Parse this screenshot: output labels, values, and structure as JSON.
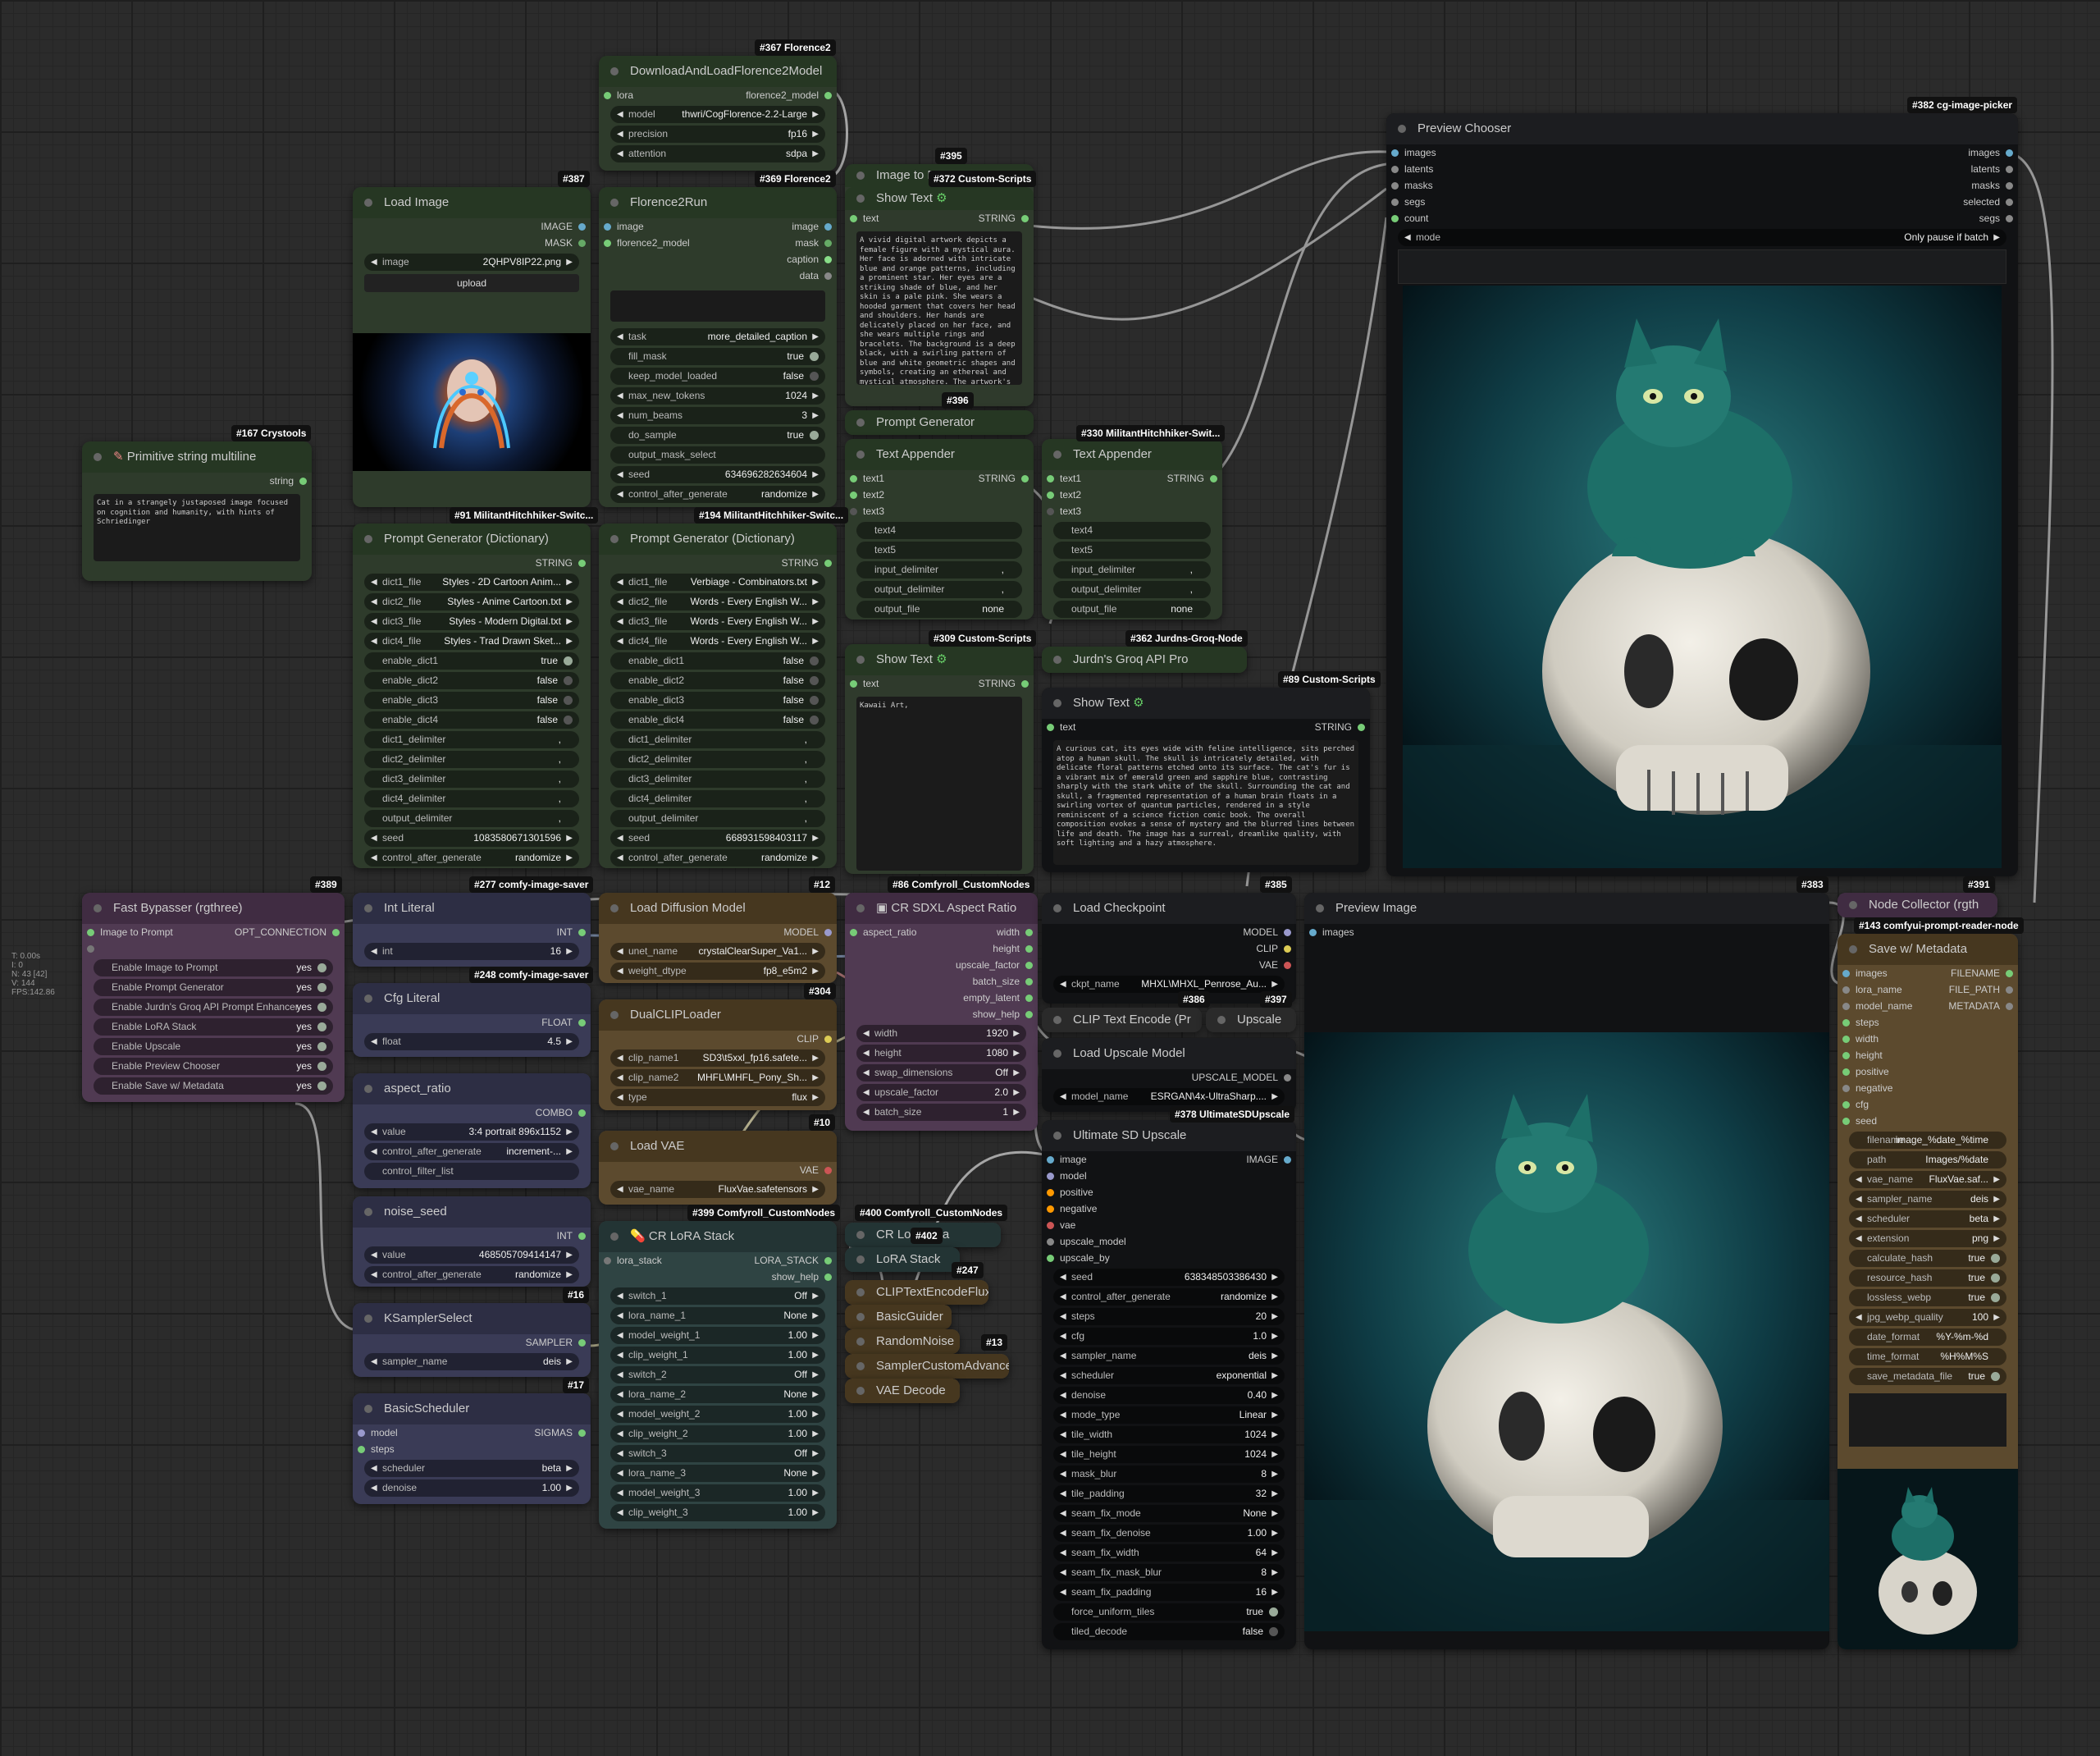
{
  "hud": [
    "T: 0.00s",
    "I: 0",
    "N: 43 [42]",
    "V: 144",
    "FPS:142.86"
  ],
  "nodes": {
    "florence_load": {
      "tag": "#367 Florence2",
      "title": "DownloadAndLoadFlorence2Model",
      "in": "lora",
      "out": "florence2_model",
      "w": [
        {
          "l": "model",
          "v": "thwri/CogFlorence-2.2-Large"
        },
        {
          "l": "precision",
          "v": "fp16"
        },
        {
          "l": "attention",
          "v": "sdpa"
        }
      ]
    },
    "load_image": {
      "tag": "#387",
      "title": "Load Image",
      "outs": [
        "IMAGE",
        "MASK"
      ],
      "w": [
        {
          "l": "image",
          "v": "2QHPV8IP22.png"
        }
      ],
      "upload": "upload"
    },
    "florence_run": {
      "tag": "#369 Florence2",
      "title": "Florence2Run",
      "ins": [
        "image",
        "florence2_model"
      ],
      "outs": [
        "image",
        "mask",
        "caption",
        "data"
      ],
      "w": [
        {
          "l": "task",
          "v": "more_detailed_caption",
          "t": "c"
        },
        {
          "l": "fill_mask",
          "v": "true",
          "t": "b"
        },
        {
          "l": "keep_model_loaded",
          "v": "false",
          "t": "b"
        },
        {
          "l": "max_new_tokens",
          "v": "1024",
          "t": "c"
        },
        {
          "l": "num_beams",
          "v": "3",
          "t": "c"
        },
        {
          "l": "do_sample",
          "v": "true",
          "t": "b"
        },
        {
          "l": "output_mask_select",
          "v": "",
          "t": "p"
        },
        {
          "l": "seed",
          "v": "634696282634604",
          "t": "c"
        },
        {
          "l": "control_after_generate",
          "v": "randomize",
          "t": "c"
        }
      ]
    },
    "show_text1": {
      "tag": "#372 Custom-Scripts",
      "tag2": "#395",
      "pre": "Image to P",
      "title": "Show Text",
      "in": "text",
      "out": "STRING",
      "text": "A vivid digital artwork depicts a female figure with a mystical aura. Her face is adorned with intricate blue and orange patterns, including a prominent star. Her eyes are a striking shade of blue, and her skin is a pale pink. She wears a hooded garment that covers her head and shoulders. Her hands are delicately placed on her face, and she wears multiple rings and bracelets. The background is a deep black, with a swirling pattern of blue and white geometric shapes and symbols, creating an ethereal and mystical atmosphere. The artwork's style resembles digital art, blending realism and"
    },
    "prompt_gen_node": {
      "tag": "#396",
      "title": "Prompt Generator",
      "sub": "MilitantHitchhiker-Swit..."
    },
    "primitive": {
      "tag": "#167 Crystools",
      "title": "Primitive string multiline",
      "out": "string",
      "text": "Cat in a strangely justaposed image focused on cognition and humanity, with hints of Schriedinger"
    },
    "pg1": {
      "tag": "#91 MilitantHitchhiker-Switc...",
      "title": "Prompt Generator (Dictionary)",
      "out": "STRING",
      "w": [
        {
          "l": "dict1_file",
          "v": "Styles - 2D Cartoon Anim...",
          "t": "c"
        },
        {
          "l": "dict2_file",
          "v": "Styles - Anime Cartoon.txt",
          "t": "c"
        },
        {
          "l": "dict3_file",
          "v": "Styles - Modern Digital.txt",
          "t": "c"
        },
        {
          "l": "dict4_file",
          "v": "Styles - Trad Drawn Sket...",
          "t": "c"
        },
        {
          "l": "enable_dict1",
          "v": "true",
          "t": "b"
        },
        {
          "l": "enable_dict2",
          "v": "false",
          "t": "b"
        },
        {
          "l": "enable_dict3",
          "v": "false",
          "t": "b"
        },
        {
          "l": "enable_dict4",
          "v": "false",
          "t": "b"
        },
        {
          "l": "dict1_delimiter",
          "v": ",",
          "t": "p"
        },
        {
          "l": "dict2_delimiter",
          "v": ",",
          "t": "p"
        },
        {
          "l": "dict3_delimiter",
          "v": ",",
          "t": "p"
        },
        {
          "l": "dict4_delimiter",
          "v": ",",
          "t": "p"
        },
        {
          "l": "output_delimiter",
          "v": ",",
          "t": "p"
        },
        {
          "l": "seed",
          "v": "1083580671301596",
          "t": "c"
        },
        {
          "l": "control_after_generate",
          "v": "randomize",
          "t": "c"
        }
      ]
    },
    "pg2": {
      "tag": "#194 MilitantHitchhiker-Switc...",
      "title": "Prompt Generator (Dictionary)",
      "out": "STRING",
      "w": [
        {
          "l": "dict1_file",
          "v": "Verbiage - Combinators.txt",
          "t": "c"
        },
        {
          "l": "dict2_file",
          "v": "Words - Every English W...",
          "t": "c"
        },
        {
          "l": "dict3_file",
          "v": "Words - Every English W...",
          "t": "c"
        },
        {
          "l": "dict4_file",
          "v": "Words - Every English W...",
          "t": "c"
        },
        {
          "l": "enable_dict1",
          "v": "false",
          "t": "b"
        },
        {
          "l": "enable_dict2",
          "v": "false",
          "t": "b"
        },
        {
          "l": "enable_dict3",
          "v": "false",
          "t": "b"
        },
        {
          "l": "enable_dict4",
          "v": "false",
          "t": "b"
        },
        {
          "l": "dict1_delimiter",
          "v": ",",
          "t": "p"
        },
        {
          "l": "dict2_delimiter",
          "v": ",",
          "t": "p"
        },
        {
          "l": "dict3_delimiter",
          "v": ",",
          "t": "p"
        },
        {
          "l": "dict4_delimiter",
          "v": ",",
          "t": "p"
        },
        {
          "l": "output_delimiter",
          "v": ",",
          "t": "p"
        },
        {
          "l": "seed",
          "v": "668931598403117",
          "t": "c"
        },
        {
          "l": "control_after_generate",
          "v": "randomize",
          "t": "c"
        }
      ]
    },
    "ta1": {
      "title": "Text Appender",
      "ins": [
        "text1",
        "text2",
        "text3"
      ],
      "out": "STRING",
      "w": [
        {
          "l": "text4",
          "v": ""
        },
        {
          "l": "text5",
          "v": ""
        },
        {
          "l": "input_delimiter",
          "v": ","
        },
        {
          "l": "output_delimiter",
          "v": ","
        },
        {
          "l": "output_file",
          "v": "none"
        }
      ]
    },
    "ta2": {
      "tag": "#330 MilitantHitchhiker-Swit...",
      "title": "Text Appender",
      "ins": [
        "text1",
        "text2",
        "text3"
      ],
      "out": "STRING",
      "w": [
        {
          "l": "text4",
          "v": ""
        },
        {
          "l": "text5",
          "v": ""
        },
        {
          "l": "input_delimiter",
          "v": ","
        },
        {
          "l": "output_delimiter",
          "v": ","
        },
        {
          "l": "output_file",
          "v": "none"
        }
      ]
    },
    "show_text2": {
      "tag": "#309 Custom-Scripts",
      "title": "Show Text",
      "in": "text",
      "out": "STRING",
      "text": "Kawaii Art,"
    },
    "groq": {
      "tag": "#362 Jurdns-Groq-Node",
      "title": "Jurdn's Groq API Pro"
    },
    "show_text3": {
      "tag": "#89 Custom-Scripts",
      "title": "Show Text",
      "in": "text",
      "out": "STRING",
      "text": "A curious cat, its eyes wide with feline intelligence, sits perched atop a human skull. The skull is intricately detailed, with delicate floral patterns etched onto its surface. The cat's fur is a vibrant mix of emerald green and sapphire blue, contrasting sharply with the stark white of the skull. Surrounding the cat and skull, a fragmented representation of a human brain floats in a swirling vortex of quantum particles, rendered in a style reminiscent of a science fiction comic book. The overall composition evokes a sense of mystery and the blurred lines between life and death. The image has a surreal, dreamlike quality, with soft lighting and a hazy atmosphere."
    },
    "preview_chooser": {
      "tag": "#382 cg-image-picker",
      "title": "Preview Chooser",
      "ins": [
        "images",
        "latents",
        "masks",
        "segs",
        "count"
      ],
      "outs": [
        "images",
        "latents",
        "masks",
        "selected",
        "segs"
      ],
      "w": [
        {
          "l": "mode",
          "v": "Only pause if batch"
        }
      ]
    },
    "fast_bypass": {
      "tag": "#389",
      "title": "Fast Bypasser (rgthree)",
      "in": "Image to Prompt",
      "out": "OPT_CONNECTION",
      "w": [
        {
          "l": "Enable Image to Prompt",
          "v": "yes"
        },
        {
          "l": "Enable Prompt Generator",
          "v": "yes"
        },
        {
          "l": "Enable Jurdn's Groq API Prompt Enhancer",
          "v": "yes"
        },
        {
          "l": "Enable LoRA Stack",
          "v": "yes"
        },
        {
          "l": "Enable Upscale",
          "v": "yes"
        },
        {
          "l": "Enable Preview Chooser",
          "v": "yes"
        },
        {
          "l": "Enable Save w/ Metadata",
          "v": "yes"
        }
      ]
    },
    "int_literal": {
      "tag": "#277 comfy-image-saver",
      "title": "Int Literal",
      "out": "INT",
      "w": [
        {
          "l": "int",
          "v": "16"
        }
      ]
    },
    "cfg_literal": {
      "tag": "#248 comfy-image-saver",
      "title": "Cfg Literal",
      "out": "FLOAT",
      "w": [
        {
          "l": "float",
          "v": "4.5"
        }
      ]
    },
    "aspect": {
      "title": "aspect_ratio",
      "out": "COMBO",
      "w": [
        {
          "l": "value",
          "v": "3:4 portrait 896x1152"
        },
        {
          "l": "control_after_generate",
          "v": "increment-..."
        },
        {
          "l": "control_filter_list",
          "v": ""
        }
      ]
    },
    "noise": {
      "title": "noise_seed",
      "out": "INT",
      "w": [
        {
          "l": "value",
          "v": "468505709414147"
        },
        {
          "l": "control_after_generate",
          "v": "randomize"
        }
      ]
    },
    "ksampler": {
      "tag": "#16",
      "title": "KSamplerSelect",
      "out": "SAMPLER",
      "w": [
        {
          "l": "sampler_name",
          "v": "deis"
        }
      ]
    },
    "basic_sched": {
      "tag": "#17",
      "title": "BasicScheduler",
      "ins": [
        "model",
        "steps"
      ],
      "out": "SIGMAS",
      "w": [
        {
          "l": "scheduler",
          "v": "beta"
        },
        {
          "l": "denoise",
          "v": "1.00"
        }
      ]
    },
    "load_diff": {
      "tag": "#12",
      "title": "Load Diffusion Model",
      "out": "MODEL",
      "w": [
        {
          "l": "unet_name",
          "v": "crystalClearSuper_Va1..."
        },
        {
          "l": "weight_dtype",
          "v": "fp8_e5m2"
        }
      ]
    },
    "dual_clip": {
      "tag": "#304",
      "title": "DualCLIPLoader",
      "out": "CLIP",
      "w": [
        {
          "l": "clip_name1",
          "v": "SD3\\t5xxl_fp16.safete..."
        },
        {
          "l": "clip_name2",
          "v": "MHFL\\MHFL_Pony_Sh..."
        },
        {
          "l": "type",
          "v": "flux"
        }
      ]
    },
    "load_vae": {
      "tag": "#10",
      "title": "Load VAE",
      "out": "VAE",
      "w": [
        {
          "l": "vae_name",
          "v": "FluxVae.safetensors"
        }
      ]
    },
    "lora_stack": {
      "tag": "#399 Comfyroll_CustomNodes",
      "title": "CR LoRA Stack",
      "in": "lora_stack",
      "outs": [
        "LORA_STACK",
        "show_help"
      ],
      "w": [
        {
          "l": "switch_1",
          "v": "Off"
        },
        {
          "l": "lora_name_1",
          "v": "None"
        },
        {
          "l": "model_weight_1",
          "v": "1.00"
        },
        {
          "l": "clip_weight_1",
          "v": "1.00"
        },
        {
          "l": "switch_2",
          "v": "Off"
        },
        {
          "l": "lora_name_2",
          "v": "None"
        },
        {
          "l": "model_weight_2",
          "v": "1.00"
        },
        {
          "l": "clip_weight_2",
          "v": "1.00"
        },
        {
          "l": "switch_3",
          "v": "Off"
        },
        {
          "l": "lora_name_3",
          "v": "None"
        },
        {
          "l": "model_weight_3",
          "v": "1.00"
        },
        {
          "l": "clip_weight_3",
          "v": "1.00"
        }
      ]
    },
    "sdxl_aspect": {
      "tag": "#86 Comfyroll_CustomNodes",
      "title": "CR SDXL Aspect Ratio",
      "in": "aspect_ratio",
      "outs": [
        "width",
        "height",
        "upscale_factor",
        "batch_size",
        "empty_latent",
        "show_help"
      ],
      "w": [
        {
          "l": "width",
          "v": "1920"
        },
        {
          "l": "height",
          "v": "1080"
        },
        {
          "l": "swap_dimensions",
          "v": "Off"
        },
        {
          "l": "upscale_factor",
          "v": "2.0"
        },
        {
          "l": "batch_size",
          "v": "1"
        }
      ]
    },
    "collapsed": [
      {
        "tag": "#400 Comfyroll_CustomNodes",
        "title": "CR LoRA Sta"
      },
      {
        "tag": "#402",
        "title": "LoRA Stack"
      },
      {
        "tag": "#247",
        "title": "CLIPTextEncodeFlux"
      },
      {
        "title": "BasicGuider"
      },
      {
        "tag": "#13",
        "title": "RandomNoise"
      },
      {
        "title": "SamplerCustomAdvance"
      },
      {
        "title": "VAE Decode"
      }
    ],
    "load_ckpt": {
      "tag": "#385",
      "title": "Load Checkpoint",
      "outs": [
        "MODEL",
        "CLIP",
        "VAE"
      ],
      "w": [
        {
          "l": "ckpt_name",
          "v": "MHXL\\MHXL_Penrose_Au..."
        }
      ]
    },
    "clip_text": {
      "tag": "#386",
      "title": "CLIP Text Encode (Pr"
    },
    "upscale_c": {
      "tag": "#397",
      "title": "Upscale"
    },
    "load_upscale": {
      "title": "Load Upscale Model",
      "out": "UPSCALE_MODEL",
      "w": [
        {
          "l": "model_name",
          "v": "ESRGAN\\4x-UltraSharp...."
        }
      ]
    },
    "ult_upscale": {
      "tag": "#378 UltimateSDUpscale",
      "title": "Ultimate SD Upscale",
      "ins": [
        "image",
        "model",
        "positive",
        "negative",
        "vae",
        "upscale_model",
        "upscale_by"
      ],
      "out": "IMAGE",
      "w": [
        {
          "l": "seed",
          "v": "638348503386430"
        },
        {
          "l": "control_after_generate",
          "v": "randomize"
        },
        {
          "l": "steps",
          "v": "20"
        },
        {
          "l": "cfg",
          "v": "1.0"
        },
        {
          "l": "sampler_name",
          "v": "deis"
        },
        {
          "l": "scheduler",
          "v": "exponential"
        },
        {
          "l": "denoise",
          "v": "0.40"
        },
        {
          "l": "mode_type",
          "v": "Linear"
        },
        {
          "l": "tile_width",
          "v": "1024"
        },
        {
          "l": "tile_height",
          "v": "1024"
        },
        {
          "l": "mask_blur",
          "v": "8"
        },
        {
          "l": "tile_padding",
          "v": "32"
        },
        {
          "l": "seam_fix_mode",
          "v": "None"
        },
        {
          "l": "seam_fix_denoise",
          "v": "1.00"
        },
        {
          "l": "seam_fix_width",
          "v": "64"
        },
        {
          "l": "seam_fix_mask_blur",
          "v": "8"
        },
        {
          "l": "seam_fix_padding",
          "v": "16"
        },
        {
          "l": "force_uniform_tiles",
          "v": "true",
          "t": "b"
        },
        {
          "l": "tiled_decode",
          "v": "false",
          "t": "b"
        }
      ]
    },
    "preview_image": {
      "tag": "#383",
      "title": "Preview Image",
      "in": "images"
    },
    "node_collector": {
      "tag": "#391",
      "title": "Node Collector (rgth"
    },
    "save_meta": {
      "tag": "#143 comfyui-prompt-reader-node",
      "title": "Save w/ Metadata",
      "ins": [
        "images",
        "lora_name",
        "model_name",
        "steps",
        "width",
        "height",
        "positive",
        "negative",
        "cfg",
        "seed"
      ],
      "outs": [
        "FILENAME",
        "FILE_PATH",
        "METADATA"
      ],
      "w": [
        {
          "l": "filename",
          "v": "image_%date_%time",
          "t": "p"
        },
        {
          "l": "path",
          "v": "Images/%date",
          "t": "p"
        },
        {
          "l": "vae_name",
          "v": "FluxVae.saf...",
          "t": "c"
        },
        {
          "l": "sampler_name",
          "v": "deis",
          "t": "c"
        },
        {
          "l": "scheduler",
          "v": "beta",
          "t": "c"
        },
        {
          "l": "extension",
          "v": "png",
          "t": "c"
        },
        {
          "l": "calculate_hash",
          "v": "true",
          "t": "b"
        },
        {
          "l": "resource_hash",
          "v": "true",
          "t": "b"
        },
        {
          "l": "lossless_webp",
          "v": "true",
          "t": "b"
        },
        {
          "l": "jpg_webp_quality",
          "v": "100",
          "t": "c"
        },
        {
          "l": "date_format",
          "v": "%Y-%m-%d",
          "t": "p"
        },
        {
          "l": "time_format",
          "v": "%H%M%S",
          "t": "p"
        },
        {
          "l": "save_metadata_file",
          "v": "true",
          "t": "b"
        }
      ]
    }
  }
}
